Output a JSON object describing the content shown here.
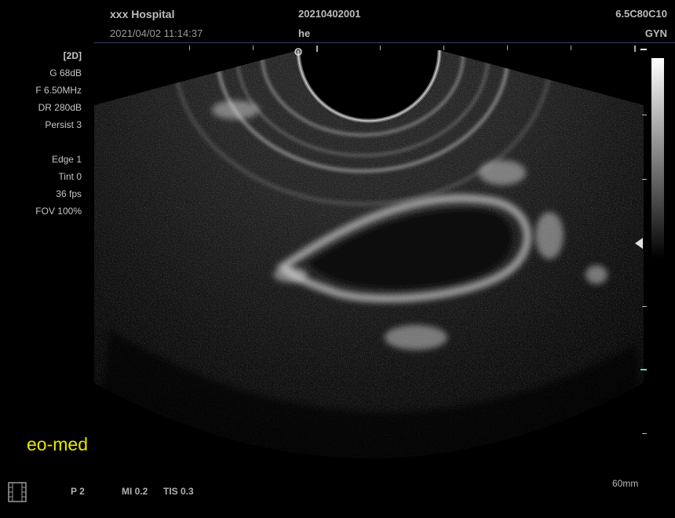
{
  "header": {
    "hospital": "xxx Hospital",
    "datetime": "2021/04/02 11:14:37",
    "patient_id": "20210402001",
    "patient_name": "he",
    "probe": "6.5C80C10",
    "exam": "GYN"
  },
  "params": {
    "mode": "[2D]",
    "gain": "G 68dB",
    "frequency": "F 6.50MHz",
    "dynamic_range": "DR 280dB",
    "persist": "Persist 3",
    "edge": "Edge 1",
    "tint": "Tint 0",
    "fps": "36 fps",
    "fov": "FOV 100%"
  },
  "footer": {
    "brand": "eo-med",
    "cine_icon": "film-icon",
    "power": "P 2",
    "mi": "MI 0.2",
    "tis": "TIS 0.3",
    "depth": "60mm"
  },
  "colors": {
    "brand": "#e8e800",
    "separator": "#2f3f63"
  }
}
